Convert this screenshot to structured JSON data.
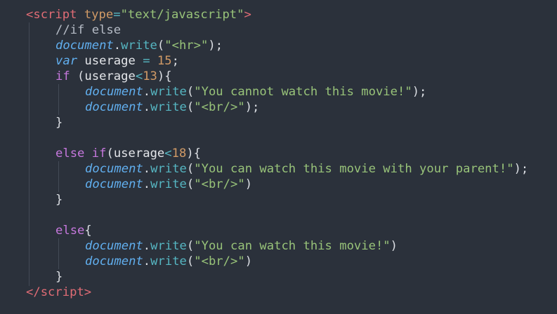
{
  "editor": {
    "background": "#2b313b",
    "colors": {
      "tag": "#e06c75",
      "attribute": "#d19a66",
      "operator": "#56b6c2",
      "string": "#98c379",
      "comment": "#b6bcc6",
      "keyword": "#c678dd",
      "object": "#61afef",
      "property": "#56b6c2",
      "number": "#d19a66",
      "default": "#dcdfe4"
    },
    "lines": [
      {
        "indent": 0,
        "tokens": [
          {
            "t": "<",
            "c": "tag"
          },
          {
            "t": "script",
            "c": "tag"
          },
          {
            "t": " ",
            "c": "punct"
          },
          {
            "t": "type",
            "c": "attr"
          },
          {
            "t": "=",
            "c": "op"
          },
          {
            "t": "\"text/javascript\"",
            "c": "str"
          },
          {
            "t": ">",
            "c": "tag"
          }
        ]
      },
      {
        "indent": 1,
        "tokens": [
          {
            "t": "//if else",
            "c": "comment"
          }
        ]
      },
      {
        "indent": 1,
        "tokens": [
          {
            "t": "document",
            "c": "obj"
          },
          {
            "t": ".",
            "c": "punct"
          },
          {
            "t": "write",
            "c": "prop"
          },
          {
            "t": "(",
            "c": "punct"
          },
          {
            "t": "\"<hr>\"",
            "c": "str"
          },
          {
            "t": ");",
            "c": "punct"
          }
        ]
      },
      {
        "indent": 1,
        "tokens": [
          {
            "t": "var",
            "c": "obj"
          },
          {
            "t": " ",
            "c": "punct"
          },
          {
            "t": "userage",
            "c": "var"
          },
          {
            "t": " ",
            "c": "punct"
          },
          {
            "t": "=",
            "c": "op"
          },
          {
            "t": " ",
            "c": "punct"
          },
          {
            "t": "15",
            "c": "num"
          },
          {
            "t": ";",
            "c": "punct"
          }
        ]
      },
      {
        "indent": 1,
        "tokens": [
          {
            "t": "if",
            "c": "kw"
          },
          {
            "t": " (",
            "c": "punct"
          },
          {
            "t": "userage",
            "c": "var"
          },
          {
            "t": "<",
            "c": "op"
          },
          {
            "t": "13",
            "c": "num"
          },
          {
            "t": "){",
            "c": "punct"
          }
        ]
      },
      {
        "indent": 2,
        "tokens": [
          {
            "t": "document",
            "c": "obj"
          },
          {
            "t": ".",
            "c": "punct"
          },
          {
            "t": "write",
            "c": "prop"
          },
          {
            "t": "(",
            "c": "punct"
          },
          {
            "t": "\"You cannot watch this movie!\"",
            "c": "str"
          },
          {
            "t": ");",
            "c": "punct"
          }
        ]
      },
      {
        "indent": 2,
        "tokens": [
          {
            "t": "document",
            "c": "obj"
          },
          {
            "t": ".",
            "c": "punct"
          },
          {
            "t": "write",
            "c": "prop"
          },
          {
            "t": "(",
            "c": "punct"
          },
          {
            "t": "\"<br/>\"",
            "c": "str"
          },
          {
            "t": ");",
            "c": "punct"
          }
        ]
      },
      {
        "indent": 1,
        "tokens": [
          {
            "t": "}",
            "c": "punct"
          }
        ]
      },
      {
        "indent": 0,
        "tokens": []
      },
      {
        "indent": 1,
        "tokens": [
          {
            "t": "else",
            "c": "kw"
          },
          {
            "t": " ",
            "c": "punct"
          },
          {
            "t": "if",
            "c": "kw"
          },
          {
            "t": "(",
            "c": "punct"
          },
          {
            "t": "userage",
            "c": "var"
          },
          {
            "t": "<",
            "c": "op"
          },
          {
            "t": "18",
            "c": "num"
          },
          {
            "t": "){",
            "c": "punct"
          }
        ]
      },
      {
        "indent": 2,
        "tokens": [
          {
            "t": "document",
            "c": "obj"
          },
          {
            "t": ".",
            "c": "punct"
          },
          {
            "t": "write",
            "c": "prop"
          },
          {
            "t": "(",
            "c": "punct"
          },
          {
            "t": "\"You can watch this movie with your parent!\"",
            "c": "str"
          },
          {
            "t": ");",
            "c": "punct"
          }
        ]
      },
      {
        "indent": 2,
        "tokens": [
          {
            "t": "document",
            "c": "obj"
          },
          {
            "t": ".",
            "c": "punct"
          },
          {
            "t": "write",
            "c": "prop"
          },
          {
            "t": "(",
            "c": "punct"
          },
          {
            "t": "\"<br/>\"",
            "c": "str"
          },
          {
            "t": ")",
            "c": "punct"
          }
        ]
      },
      {
        "indent": 1,
        "tokens": [
          {
            "t": "}",
            "c": "punct"
          }
        ]
      },
      {
        "indent": 0,
        "tokens": []
      },
      {
        "indent": 1,
        "tokens": [
          {
            "t": "else",
            "c": "kw"
          },
          {
            "t": "{",
            "c": "punct"
          }
        ]
      },
      {
        "indent": 2,
        "tokens": [
          {
            "t": "document",
            "c": "obj"
          },
          {
            "t": ".",
            "c": "punct"
          },
          {
            "t": "write",
            "c": "prop"
          },
          {
            "t": "(",
            "c": "punct"
          },
          {
            "t": "\"You can watch this movie!\"",
            "c": "str"
          },
          {
            "t": ")",
            "c": "punct"
          }
        ]
      },
      {
        "indent": 2,
        "tokens": [
          {
            "t": "document",
            "c": "obj"
          },
          {
            "t": ".",
            "c": "punct"
          },
          {
            "t": "write",
            "c": "prop"
          },
          {
            "t": "(",
            "c": "punct"
          },
          {
            "t": "\"<br/>\"",
            "c": "str"
          },
          {
            "t": ")",
            "c": "punct"
          }
        ]
      },
      {
        "indent": 1,
        "tokens": [
          {
            "t": "}",
            "c": "punct"
          }
        ]
      },
      {
        "indent": 0,
        "tokens": [
          {
            "t": "</",
            "c": "tag"
          },
          {
            "t": "script",
            "c": "tag"
          },
          {
            "t": ">",
            "c": "tag"
          }
        ]
      }
    ]
  }
}
